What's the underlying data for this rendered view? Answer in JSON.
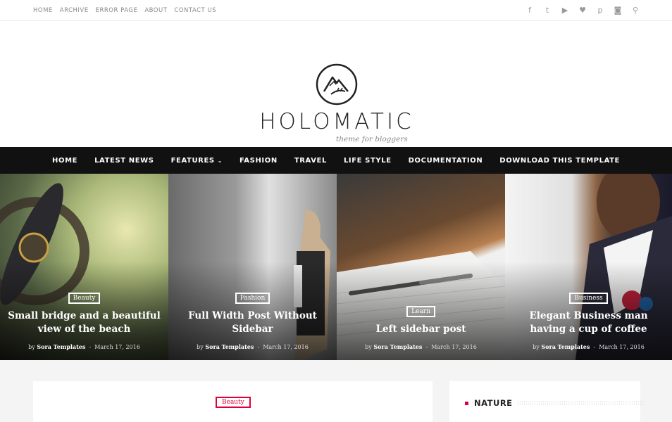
{
  "topnav": [
    "HOME",
    "ARCHIVE",
    "ERROR PAGE",
    "ABOUT",
    "CONTACT US"
  ],
  "social": [
    {
      "icon": "facebook-icon",
      "glyph": "f"
    },
    {
      "icon": "twitter-icon",
      "glyph": "t"
    },
    {
      "icon": "youtube-icon",
      "glyph": "▶"
    },
    {
      "icon": "vimeo-icon",
      "glyph": "♥"
    },
    {
      "icon": "pinterest-icon",
      "glyph": "p"
    },
    {
      "icon": "instagram-icon",
      "glyph": "◙"
    },
    {
      "icon": "search-icon",
      "glyph": "⚲"
    }
  ],
  "brand": {
    "name": "HOLOMATIC",
    "tagline": "theme for bloggers"
  },
  "mainnav": [
    "HOME",
    "LATEST NEWS",
    "FEATURES",
    "FASHION",
    "TRAVEL",
    "LIFE STYLE",
    "DOCUMENTATION",
    "DOWNLOAD THIS TEMPLATE"
  ],
  "slides": [
    {
      "category": "Beauty",
      "title": "Small bridge and a beautiful view of the beach",
      "author": "Sora Templates",
      "date": "March 17, 2016"
    },
    {
      "category": "Fashion",
      "title": "Full Width Post Without Sidebar",
      "author": "Sora Templates",
      "date": "March 17, 2016"
    },
    {
      "category": "Learn",
      "title": "Left sidebar post",
      "author": "Sora Templates",
      "date": "March 17, 2016"
    },
    {
      "category": "Business",
      "title": "Elegant Business man having a cup of coffee",
      "author": "Sora Templates",
      "date": "March 17, 2016"
    }
  ],
  "post": {
    "category": "Beauty"
  },
  "widget": {
    "title": "NATURE"
  },
  "colors": {
    "accent": "#e0003c",
    "nav": "#111111"
  }
}
